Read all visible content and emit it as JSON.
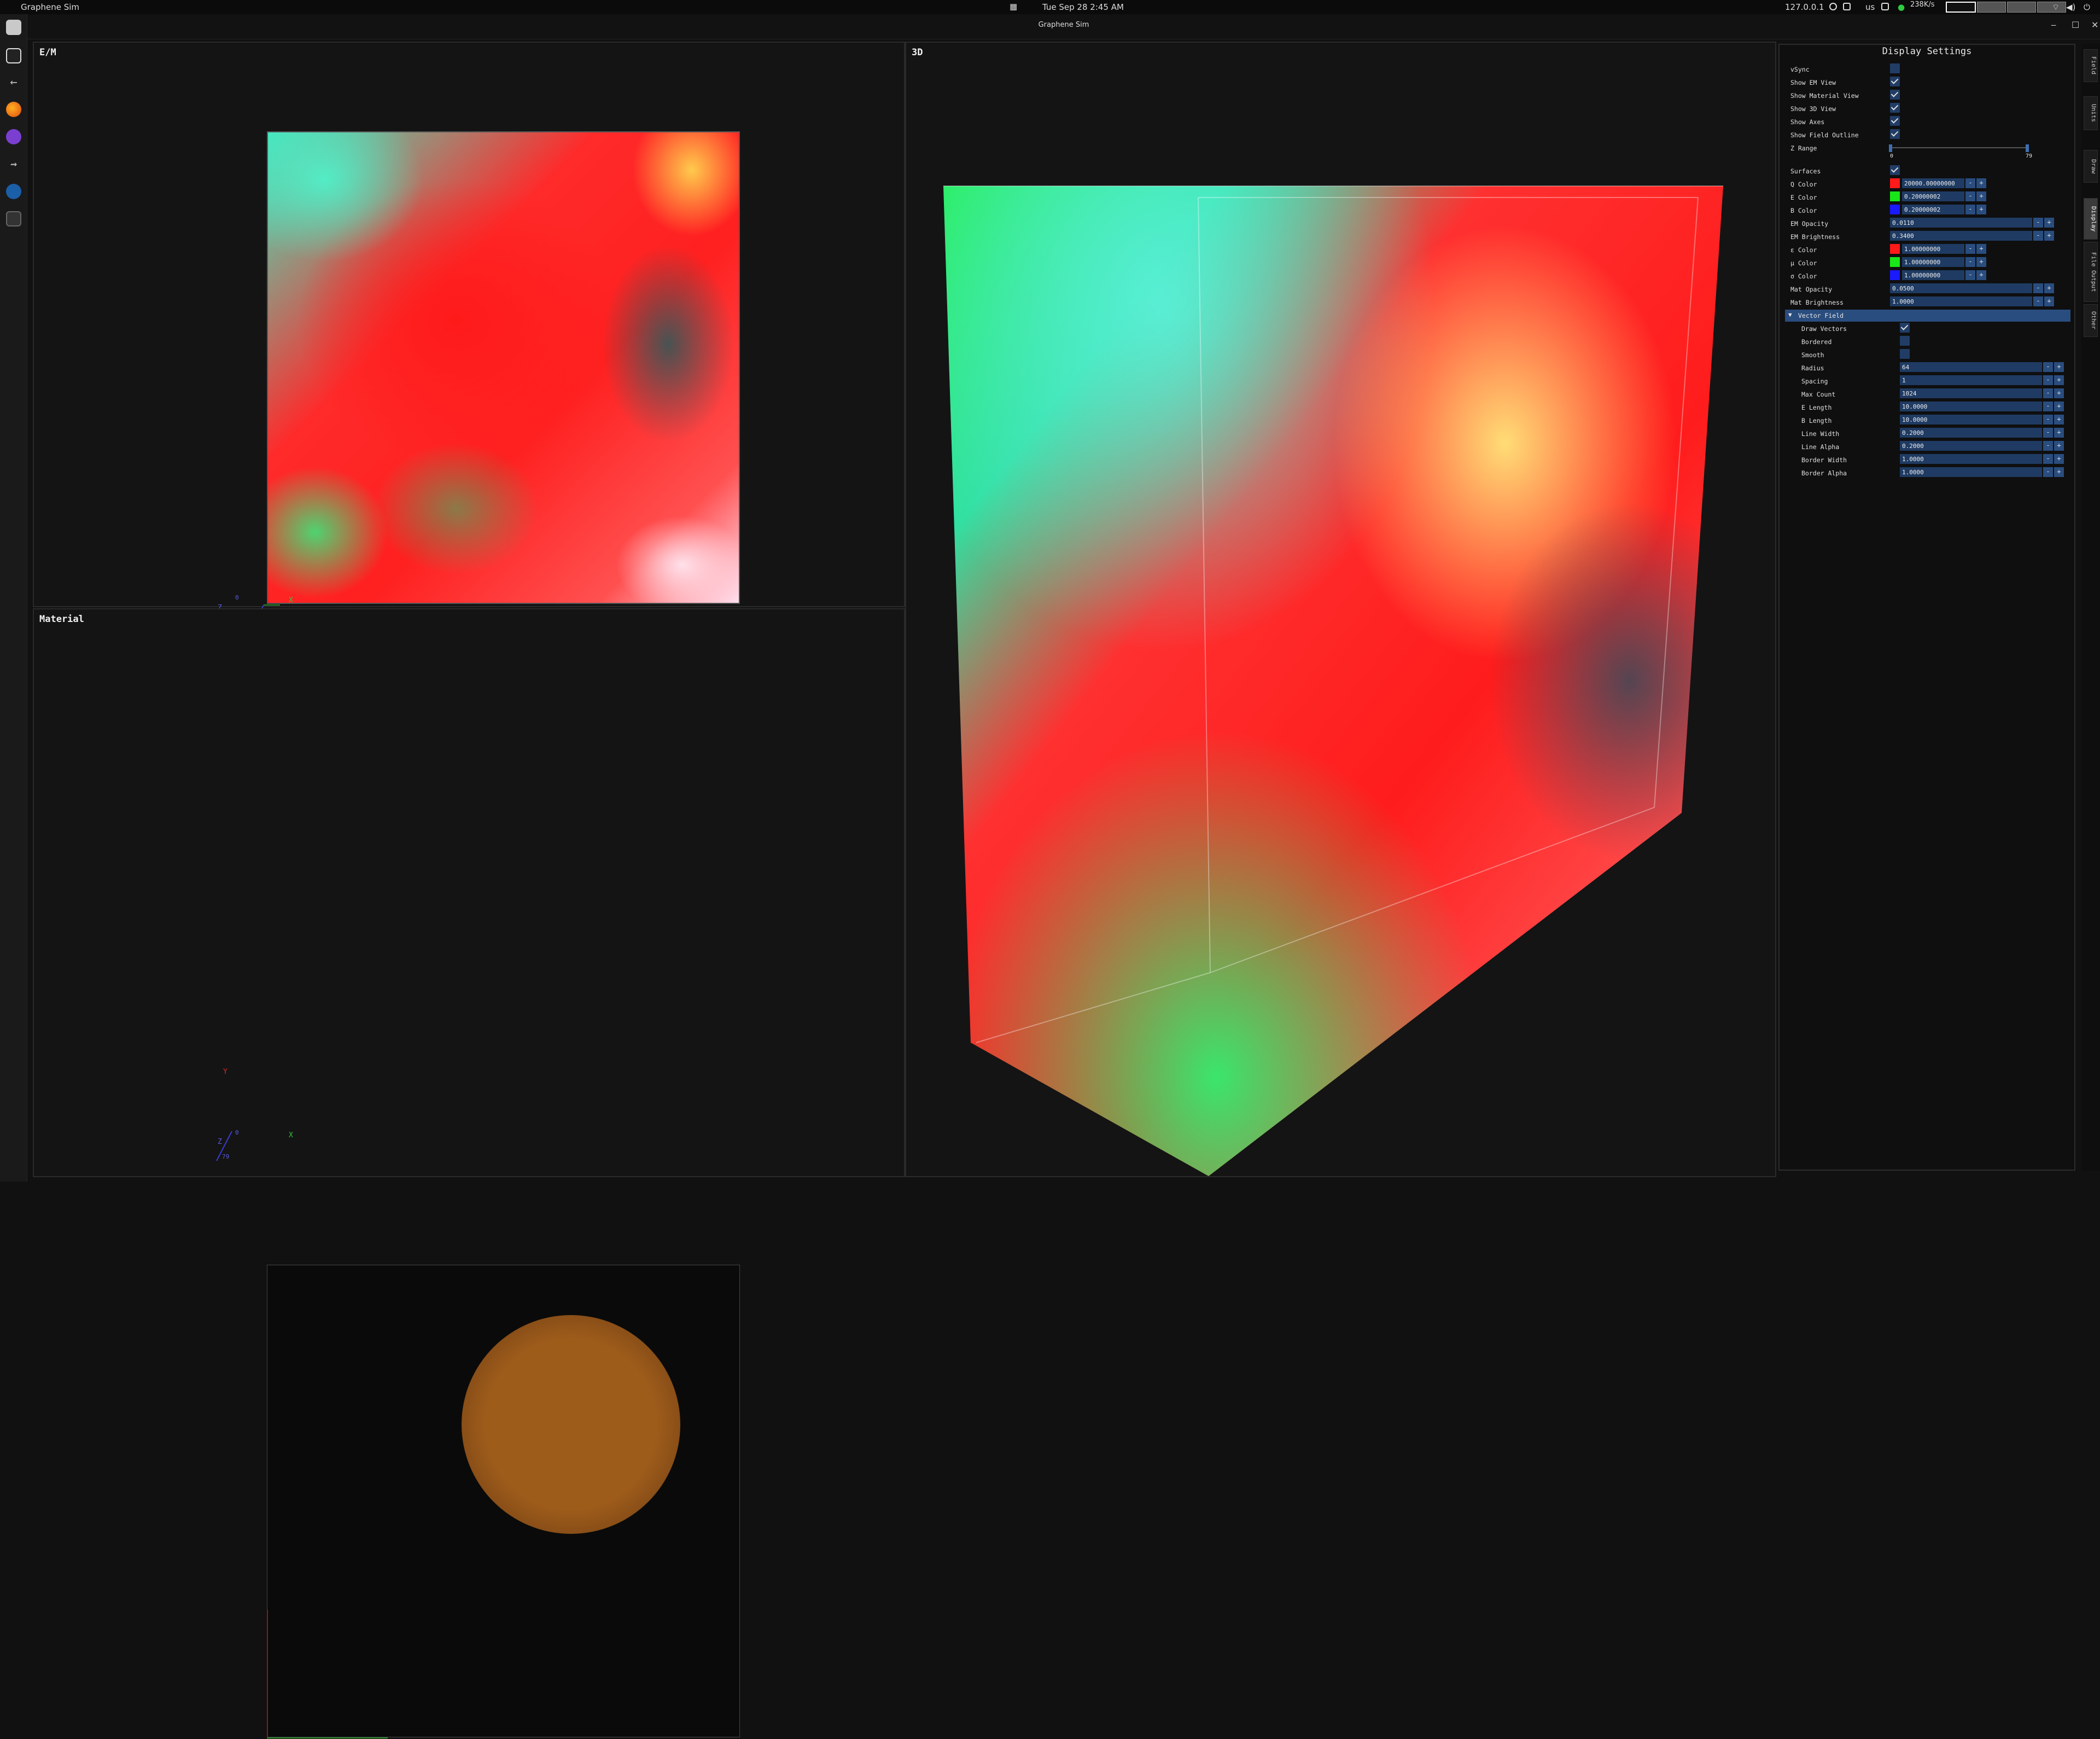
{
  "topbar": {
    "app_name": "Graphene Sim",
    "datetime": "Tue Sep 28  2:45 AM",
    "ip": "127.0.0.1",
    "lang": "us",
    "net_speed": "238K/s"
  },
  "window": {
    "title": "Graphene Sim"
  },
  "dock": {
    "icons": [
      "files-icon",
      "window-manager-icon",
      "back-arrow-icon",
      "firefox-icon",
      "emacs-icon",
      "bird-icon",
      "steam-icon",
      "graphene-sim-icon"
    ]
  },
  "panels": {
    "em": {
      "title": "E/M",
      "axis_x": "X",
      "axis_y": "Y",
      "axis_z": "Z",
      "z_value": "79",
      "z_zero": "0"
    },
    "material": {
      "title": "Material",
      "axis_x": "X",
      "axis_y": "Y",
      "axis_z": "Z",
      "z_value": "79",
      "z_zero": "0",
      "disc_color": "#9e5c1a"
    },
    "view3d": {
      "title": "3D"
    }
  },
  "settings": {
    "title": "Display Settings",
    "vsync": {
      "label": "vSync",
      "checked": false
    },
    "show_em": {
      "label": "Show EM View",
      "checked": true
    },
    "show_material": {
      "label": "Show Material View",
      "checked": true
    },
    "show_3d": {
      "label": "Show 3D View",
      "checked": true
    },
    "show_axes": {
      "label": "Show Axes",
      "checked": true
    },
    "show_outline": {
      "label": "Show Field Outline",
      "checked": true
    },
    "z_range": {
      "label": "Z Range",
      "min": "0",
      "max": "79"
    },
    "surfaces": {
      "label": "Surfaces",
      "checked": true
    },
    "q_color": {
      "label": "Q Color",
      "value": "20000.00000000",
      "color": "#ff1a1a"
    },
    "e_color": {
      "label": "E Color",
      "value": "0.20000002",
      "color": "#19e619"
    },
    "b_color": {
      "label": "B Color",
      "value": "0.20000002",
      "color": "#1a1aff"
    },
    "em_opacity": {
      "label": "EM Opacity",
      "value": "0.0110"
    },
    "em_brightness": {
      "label": "EM Brightness",
      "value": "0.3400"
    },
    "eps_color": {
      "label": "ε Color",
      "value": "1.00000000",
      "color": "#ff1a1a"
    },
    "mu_color": {
      "label": "μ Color",
      "value": "1.00000000",
      "color": "#19e619"
    },
    "sigma_color": {
      "label": "σ Color",
      "value": "1.00000000",
      "color": "#1a1aff"
    },
    "mat_opacity": {
      "label": "Mat Opacity",
      "value": "0.0500"
    },
    "mat_brightness": {
      "label": "Mat Brightness",
      "value": "1.0000"
    },
    "vector_field": {
      "label": "Vector Field",
      "draw_vectors": {
        "label": "Draw Vectors",
        "checked": true
      },
      "bordered": {
        "label": "Bordered",
        "checked": false
      },
      "smooth": {
        "label": "Smooth",
        "checked": false
      },
      "radius": {
        "label": "Radius",
        "value": "64"
      },
      "spacing": {
        "label": "Spacing",
        "value": "1"
      },
      "max_count": {
        "label": "Max Count",
        "value": "1024"
      },
      "e_length": {
        "label": "E Length",
        "value": "10.0000"
      },
      "b_length": {
        "label": "B Length",
        "value": "10.0000"
      },
      "line_width": {
        "label": "Line Width",
        "value": "0.2000"
      },
      "line_alpha": {
        "label": "Line Alpha",
        "value": "0.2000"
      },
      "border_width": {
        "label": "Border Width",
        "value": "1.0000"
      },
      "border_alpha": {
        "label": "Border Alpha",
        "value": "1.0000"
      }
    },
    "minus": "-",
    "plus": "+"
  },
  "side_tabs": [
    "Field",
    "Units",
    "Draw",
    "Display",
    "File Output",
    "Other"
  ],
  "side_tab_active": "Display"
}
